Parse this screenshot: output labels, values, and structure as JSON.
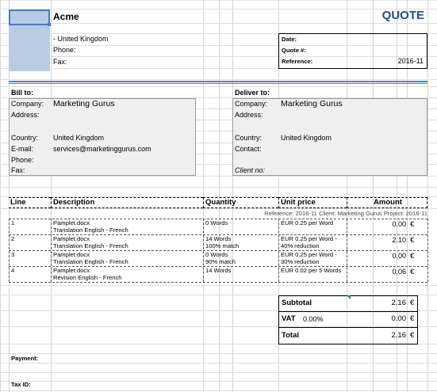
{
  "company": {
    "name": "Acme",
    "address_line": "- United Kingdom",
    "phone_label": "Phone:",
    "fax_label": "Fax:"
  },
  "doc": {
    "title": "QUOTE",
    "date_label": "Date:",
    "quote_no_label": "Quote #:",
    "reference_label": "Reference:",
    "reference_value": "2016-11"
  },
  "bill_to": {
    "heading": "Bill to:",
    "company_label": "Company:",
    "company_value": "Marketing Gurus",
    "address_label": "Address:",
    "country_label": "Country:",
    "country_value": "United Kingdom",
    "email_label": "E-mail:",
    "email_value": "services@marketinggurus.com",
    "phone_label": "Phone:",
    "fax_label": "Fax:"
  },
  "deliver_to": {
    "heading": "Deliver to:",
    "company_label": "Company:",
    "company_value": "Marketing Gurus",
    "address_label": "Address:",
    "country_label": "Country:",
    "country_value": "United Kingdom",
    "contact_label": "Contact:",
    "client_no_label": "Client no:"
  },
  "table": {
    "headers": {
      "line": "Line",
      "description": "Description",
      "quantity": "Quantity",
      "unit_price": "Unit price",
      "amount": "Amount"
    },
    "ref_line": "Reference: 2016-11   Client: Marketing Gurus   Project: 2016-11",
    "rows": [
      {
        "line": "1",
        "desc1": "Pamplet.docx",
        "desc2": "Translation English - French",
        "qty1": "0 Words",
        "qty2": "",
        "price1": "EUR 0.25 per Word",
        "price2": "",
        "amount": "0.00",
        "cur": "€"
      },
      {
        "line": "2",
        "desc1": "Pamplet.docx",
        "desc2": "Translation English - French",
        "qty1": "14 Words",
        "qty2": "100% match",
        "price1": "EUR 0.25 per Word  -",
        "price2": "40% reduction",
        "amount": "2.10",
        "cur": "€"
      },
      {
        "line": "3",
        "desc1": "Pamplet.docx",
        "desc2": "Translation English - French",
        "qty1": "0 Words",
        "qty2": "90% match",
        "price1": "EUR 0.25 per Word  -",
        "price2": "30% reduction",
        "amount": "0.00",
        "cur": "€"
      },
      {
        "line": "4",
        "desc1": "Pamplet.docx",
        "desc2": "Revision English - French",
        "qty1": "14 Words",
        "qty2": "",
        "price1": "EUR 0.02 per 5 Words",
        "price2": "",
        "amount": "0.06",
        "cur": "€"
      }
    ]
  },
  "totals": {
    "subtotal_label": "Subtotal",
    "subtotal_value": "2.16",
    "vat_label": "VAT",
    "vat_rate": "0.00%",
    "vat_value": "0.00",
    "total_label": "Total",
    "total_value": "2.16",
    "cur": "€"
  },
  "footer": {
    "payment_label": "Payment:",
    "tax_id_label": "Tax ID:"
  },
  "colors": {
    "accent": "#4f81bd",
    "title_blue": "#1f4e8c",
    "cell_highlight": "#b8cce4",
    "gray_fill": "#efefef"
  }
}
